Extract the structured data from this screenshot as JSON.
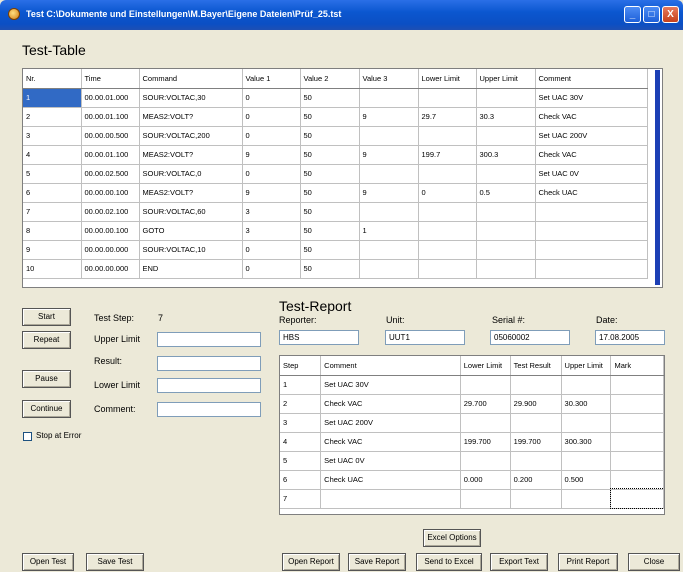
{
  "window": {
    "title": "Test C:\\Dokumente und Einstellungen\\M.Bayer\\Eigene Dateien\\Prüf_25.tst",
    "min_glyph": "_",
    "max_glyph": "□",
    "close_glyph": "X"
  },
  "test_table": {
    "title": "Test-Table",
    "columns": [
      "Nr.",
      "Time",
      "Command",
      "Value 1",
      "Value 2",
      "Value 3",
      "Lower Limit",
      "Upper Limit",
      "Comment"
    ],
    "rows": [
      [
        "1",
        "00.00.01.000",
        "SOUR:VOLTAC,30",
        "0",
        "50",
        "",
        "",
        "",
        "Set UAC 30V"
      ],
      [
        "2",
        "00.00.01.100",
        "MEAS2:VOLT?",
        "0",
        "50",
        "9",
        "29.7",
        "30.3",
        "Check VAC"
      ],
      [
        "3",
        "00.00.00.500",
        "SOUR:VOLTAC,200",
        "0",
        "50",
        "",
        "",
        "",
        "Set UAC 200V"
      ],
      [
        "4",
        "00.00.01.100",
        "MEAS2:VOLT?",
        "9",
        "50",
        "9",
        "199.7",
        "300.3",
        "Check VAC"
      ],
      [
        "5",
        "00.00.02.500",
        "SOUR:VOLTAC,0",
        "0",
        "50",
        "",
        "",
        "",
        "Set UAC 0V"
      ],
      [
        "6",
        "00.00.00.100",
        "MEAS2:VOLT?",
        "9",
        "50",
        "9",
        "0",
        "0.5",
        "Check UAC"
      ],
      [
        "7",
        "00.00.02.100",
        "SOUR:VOLTAC,60",
        "3",
        "50",
        "",
        "",
        "",
        ""
      ],
      [
        "8",
        "00.00.00.100",
        "GOTO",
        "3",
        "50",
        "1",
        "",
        "",
        ""
      ],
      [
        "9",
        "00.00.00.000",
        "SOUR:VOLTAC,10",
        "0",
        "50",
        "",
        "",
        "",
        ""
      ],
      [
        "10",
        "00.00.00.000",
        "END",
        "0",
        "50",
        "",
        "",
        "",
        ""
      ]
    ]
  },
  "controls": {
    "start": "Start",
    "repeat": "Repeat",
    "pause": "Pause",
    "continue": "Continue",
    "stop_at_error": "Stop at Error",
    "test_step_label": "Test Step:",
    "test_step_value": "7",
    "upper_limit_label": "Upper Limit",
    "result_label": "Result:",
    "lower_limit_label": "Lower Limit",
    "comment_label": "Comment:",
    "upper_limit_value": "",
    "result_value": "",
    "lower_limit_value": "",
    "comment_value": ""
  },
  "test_report": {
    "title": "Test-Report",
    "reporter_label": "Reporter:",
    "reporter_value": "HBS",
    "unit_label": "Unit:",
    "unit_value": "UUT1",
    "serial_label": "Serial #:",
    "serial_value": "05060002",
    "date_label": "Date:",
    "date_value": "17.08.2005",
    "columns": [
      "Step",
      "Comment",
      "Lower Limit",
      "Test Result",
      "Upper Limit",
      "Mark"
    ],
    "rows": [
      [
        "1",
        "Set UAC 30V",
        "",
        "",
        "",
        ""
      ],
      [
        "2",
        "Check VAC",
        "29.700",
        "29.900",
        "30.300",
        ""
      ],
      [
        "3",
        "Set UAC 200V",
        "",
        "",
        "",
        ""
      ],
      [
        "4",
        "Check VAC",
        "199.700",
        "199.700",
        "300.300",
        ""
      ],
      [
        "5",
        "Set UAC 0V",
        "",
        "",
        "",
        ""
      ],
      [
        "6",
        "Check UAC",
        "0.000",
        "0.200",
        "0.500",
        ""
      ],
      [
        "7",
        "",
        "",
        "",
        "",
        ""
      ]
    ]
  },
  "buttons": {
    "excel_options": "Excel Options",
    "open_test": "Open Test",
    "save_test": "Save Test",
    "open_report": "Open Report",
    "save_report": "Save Report",
    "send_to_excel": "Send to Excel",
    "export_text": "Export Text",
    "print_report": "Print Report",
    "close": "Close"
  }
}
